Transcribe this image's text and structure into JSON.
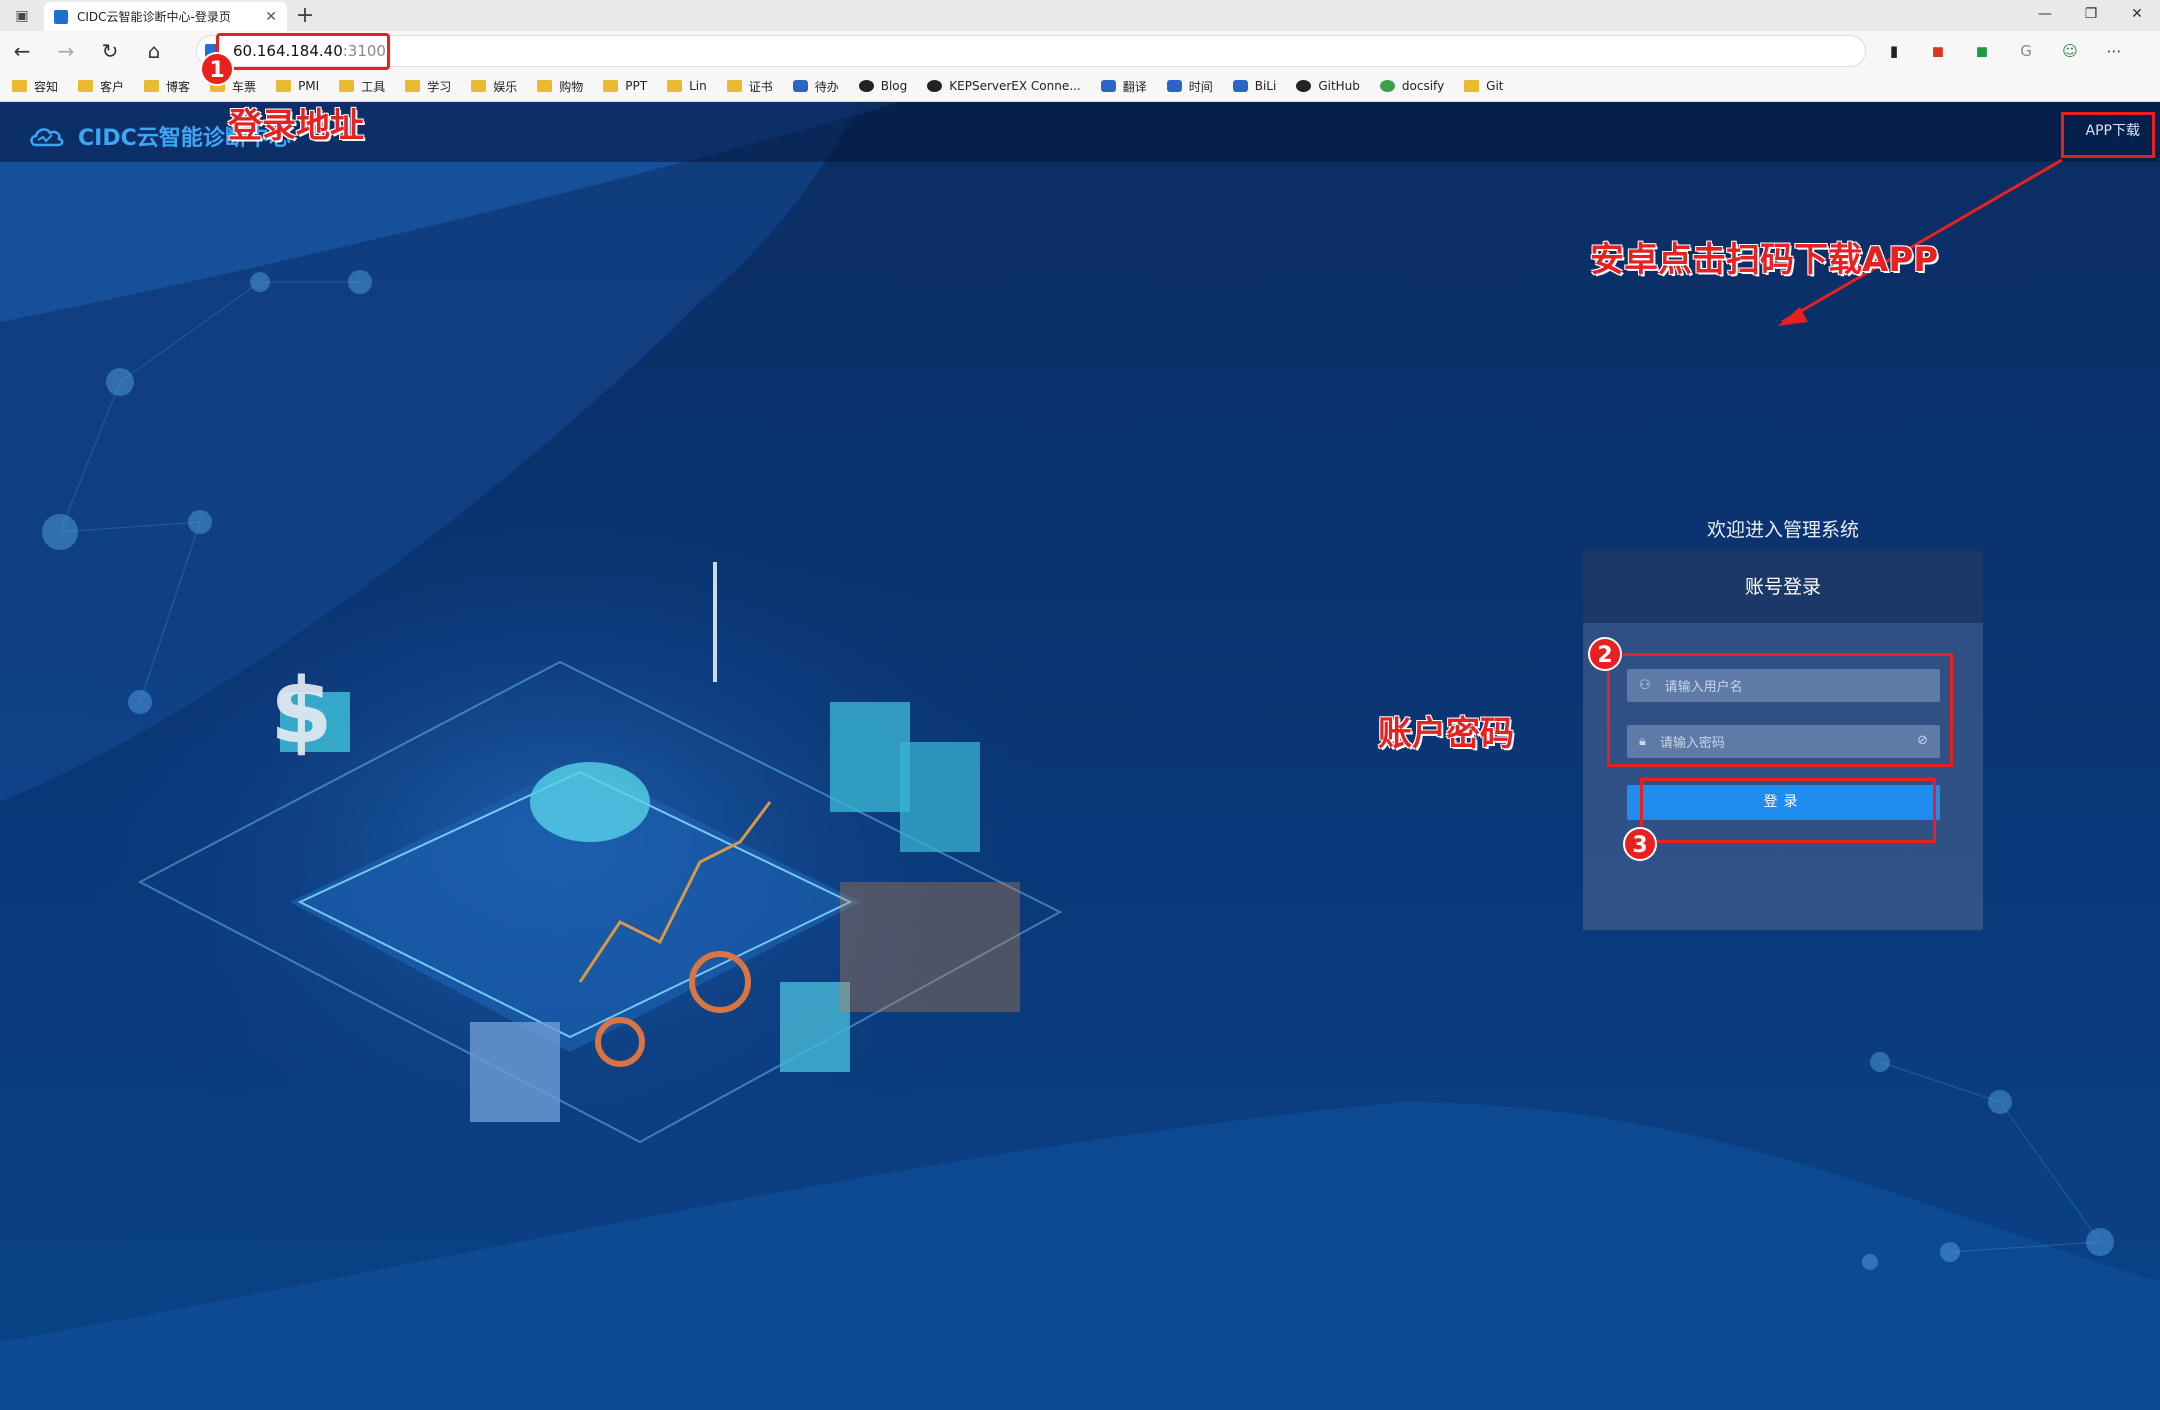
{
  "browser": {
    "tab_title": "CIDC云智能诊断中心-登录页",
    "address_host": "60.164.184.40",
    "address_port": ":3100",
    "new_tab_label": "+",
    "bookmarks": [
      "容知",
      "客户",
      "博客",
      "车票",
      "PMI",
      "工具",
      "学习",
      "娱乐",
      "购物",
      "PPT",
      "Lin",
      "证书",
      "待办",
      "Blog",
      "KEPServerEX Conne...",
      "翻译",
      "时间",
      "BiLi",
      "GitHub",
      "docsify",
      "Git"
    ]
  },
  "page": {
    "logo_text": "CIDC云智能诊断中心",
    "app_download": "APP下载",
    "welcome": "欢迎进入管理系统",
    "card_title": "账号登录",
    "username_placeholder": "请输入用户名",
    "password_placeholder": "请输入密码",
    "login_button": "登录"
  },
  "annotations": {
    "address_note": "登录地址",
    "app_note": "安卓点击扫码下载APP",
    "account_note": "账户密码",
    "badge1": "1",
    "badge2": "2",
    "badge3": "3",
    "color": "#e8201f"
  },
  "colors": {
    "page_bg": "#0a3574",
    "accent": "#1f8cf0",
    "logo": "#3ea6f5"
  }
}
